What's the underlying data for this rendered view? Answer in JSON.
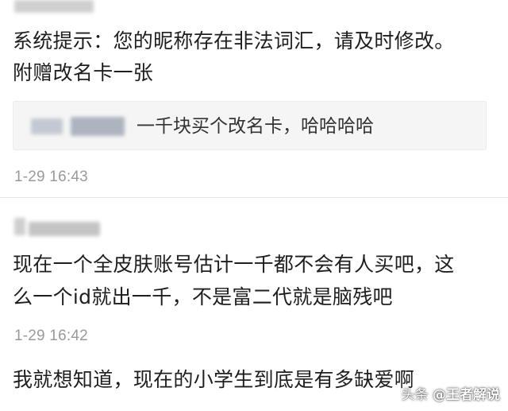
{
  "comment1": {
    "line1": "系统提示：您的昵称存在非法词汇，请及时修改。",
    "line2": "附赠改名卡一张",
    "quote": "一千块买个改名卡，哈哈哈哈",
    "time": "1-29 16:43"
  },
  "comment2": {
    "line1": "现在一个全皮肤账号估计一千都不会有人买吧，这",
    "line2": "么一个id就出一千，不是富二代就是脑残吧",
    "time": "1-29 16:42"
  },
  "comment3": {
    "line1": "我就想知道，现在的小学生到底是有多缺爱啊"
  },
  "watermark": {
    "source": "头条",
    "handle": "@王者解说"
  }
}
